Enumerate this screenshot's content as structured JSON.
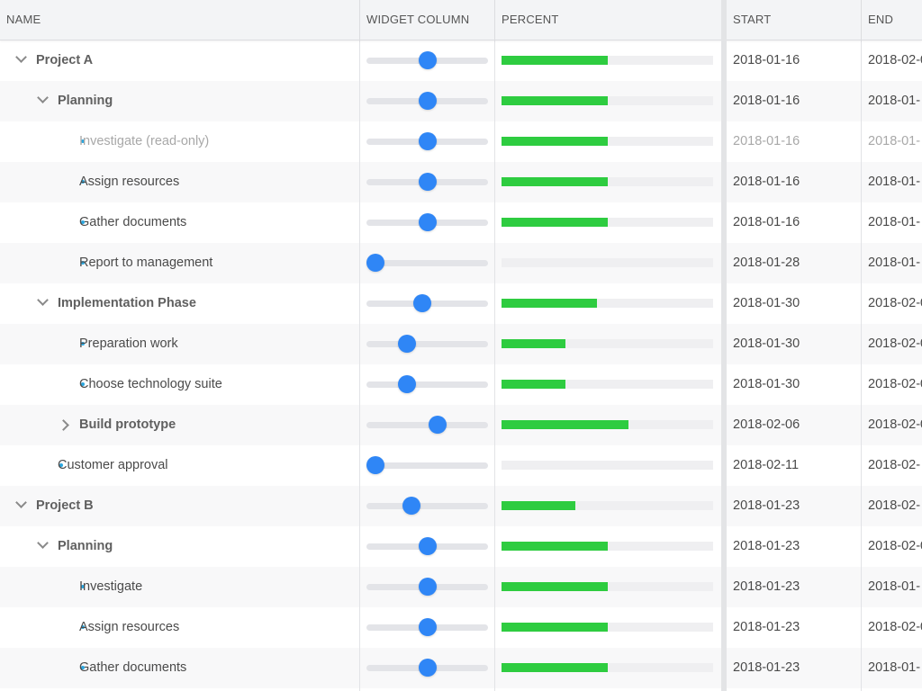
{
  "colors": {
    "accent": "#2f86f6",
    "progress": "#2ecc40",
    "bullet": "#2aa7e0"
  },
  "columns": {
    "name": "NAME",
    "widget": "WIDGET COLUMN",
    "percent": "PERCENT",
    "start": "START",
    "end": "END"
  },
  "rows": [
    {
      "name": "Project A",
      "level": 0,
      "type": "parent",
      "expander": "chevron-down-icon",
      "percent": 50,
      "start": "2018-01-16",
      "end": "2018-02-0"
    },
    {
      "name": "Planning",
      "level": 1,
      "type": "parent",
      "expander": "chevron-down-icon",
      "percent": 50,
      "start": "2018-01-16",
      "end": "2018-01-"
    },
    {
      "name": "Investigate (read-only)",
      "level": 2,
      "type": "leaf",
      "readonly": true,
      "percent": 50,
      "start": "2018-01-16",
      "end": "2018-01-"
    },
    {
      "name": "Assign resources",
      "level": 2,
      "type": "leaf",
      "percent": 50,
      "start": "2018-01-16",
      "end": "2018-01-"
    },
    {
      "name": "Gather documents",
      "level": 2,
      "type": "leaf",
      "percent": 50,
      "start": "2018-01-16",
      "end": "2018-01-"
    },
    {
      "name": "Report to management",
      "level": 2,
      "type": "leaf",
      "percent": 0,
      "start": "2018-01-28",
      "end": "2018-01-"
    },
    {
      "name": "Implementation Phase",
      "level": 1,
      "type": "parent",
      "expander": "chevron-down-icon",
      "percent": 45,
      "start": "2018-01-30",
      "end": "2018-02-0"
    },
    {
      "name": "Preparation work",
      "level": 2,
      "type": "leaf",
      "percent": 30,
      "start": "2018-01-30",
      "end": "2018-02-0"
    },
    {
      "name": "Choose technology suite",
      "level": 2,
      "type": "leaf",
      "percent": 30,
      "start": "2018-01-30",
      "end": "2018-02-0"
    },
    {
      "name": "Build prototype",
      "level": 2,
      "type": "parent",
      "expander": "chevron-right-icon",
      "percent": 60,
      "start": "2018-02-06",
      "end": "2018-02-0"
    },
    {
      "name": "Customer approval",
      "level": 1,
      "type": "leaf",
      "percent": 0,
      "start": "2018-02-11",
      "end": "2018-02-"
    },
    {
      "name": "Project B",
      "level": 0,
      "type": "parent",
      "expander": "chevron-down-icon",
      "percent": 35,
      "start": "2018-01-23",
      "end": "2018-02-"
    },
    {
      "name": "Planning",
      "level": 1,
      "type": "parent",
      "expander": "chevron-down-icon",
      "percent": 50,
      "start": "2018-01-23",
      "end": "2018-02-0"
    },
    {
      "name": "Investigate",
      "level": 2,
      "type": "leaf",
      "percent": 50,
      "start": "2018-01-23",
      "end": "2018-01-"
    },
    {
      "name": "Assign resources",
      "level": 2,
      "type": "leaf",
      "percent": 50,
      "start": "2018-01-23",
      "end": "2018-02-0"
    },
    {
      "name": "Gather documents",
      "level": 2,
      "type": "leaf",
      "percent": 50,
      "start": "2018-01-23",
      "end": "2018-01-"
    }
  ]
}
